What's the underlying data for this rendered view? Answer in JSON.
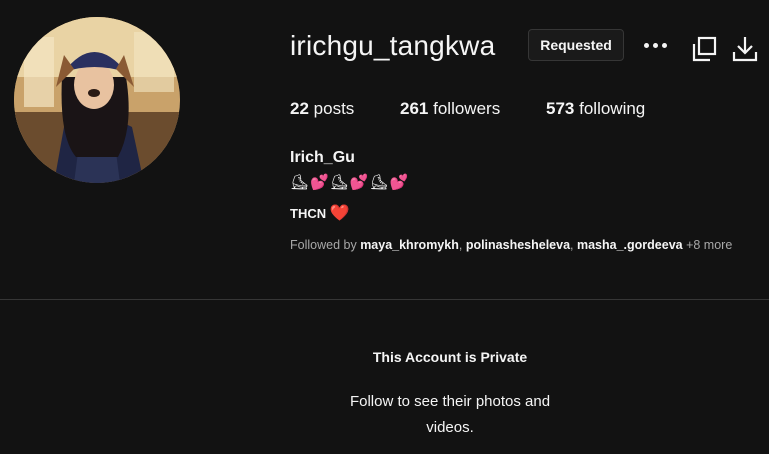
{
  "profile": {
    "username": "irichgu_tangkwa",
    "request_button": "Requested",
    "more_icon": "more-horizontal-icon",
    "copy_icon": "copy-icon",
    "download_icon": "download-icon",
    "stats": {
      "posts_count": "22",
      "posts_label": "posts",
      "followers_count": "261",
      "followers_label": "followers",
      "following_count": "573",
      "following_label": "following"
    },
    "full_name": "Irich_Gu",
    "bio_line1": "⛸💕⛸💕⛸💕",
    "bio_line2_text": "THCN",
    "bio_line2_emoji": "❤️",
    "followed_by": {
      "prefix": "Followed by",
      "users": [
        "maya_khromykh",
        "polinashesheleva",
        "masha_.gordeeva"
      ],
      "more": "+8 more"
    }
  },
  "private_notice": {
    "title": "This Account is Private",
    "description": "Follow to see their photos and videos."
  },
  "colors": {
    "background": "#121212",
    "text": "#f5f5f5",
    "muted": "#a8a8a8",
    "divider": "#363636",
    "heart": "#e0245e"
  }
}
